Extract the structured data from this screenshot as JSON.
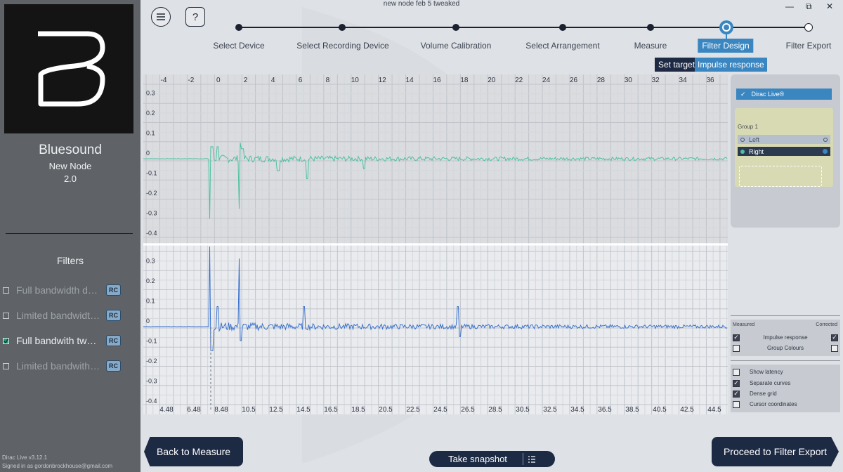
{
  "window": {
    "title": "new node feb 5 tweaked",
    "controls": [
      "—",
      "⧉",
      "✕"
    ]
  },
  "device": {
    "brand": "Bluesound",
    "name": "New Node",
    "version": "2.0"
  },
  "filters": {
    "heading": "Filters",
    "items": [
      {
        "label": "Full bandwidth default",
        "badge": "RC",
        "checked": false
      },
      {
        "label": "Limited bandwidth default",
        "badge": "RC",
        "checked": false
      },
      {
        "label": "Full bandwith tweaked",
        "badge": "RC",
        "checked": true
      },
      {
        "label": "Limited bandwith tweaked",
        "badge": "RC",
        "checked": false
      }
    ]
  },
  "footer": {
    "app_version": "Dirac Live v3.12.1",
    "signed_in": "Signed in as gordonbrockhouse@gmail.com"
  },
  "toolbar": {
    "menu_icon": "menu-icon",
    "help_label": "?"
  },
  "steps": {
    "items": [
      "Select Device",
      "Select Recording Device",
      "Volume Calibration",
      "Select Arrangement",
      "Measure",
      "Filter Design",
      "Filter Export"
    ],
    "active_index": 5
  },
  "view_tabs": {
    "set_target": "Set target",
    "impulse_response": "Impulse response",
    "active": "Impulse response"
  },
  "plot": {
    "top_axis_labels": [
      "-4",
      "-2",
      "0",
      "2",
      "4",
      "6",
      "8",
      "10",
      "12",
      "14",
      "16",
      "18",
      "20",
      "22",
      "24",
      "26",
      "28",
      "30",
      "32",
      "34",
      "36"
    ],
    "bottom_axis_labels": [
      "4.48",
      "6.48",
      "8.48",
      "10.5",
      "12.5",
      "14.5",
      "16.5",
      "18.5",
      "20.5",
      "22.5",
      "24.5",
      "26.5",
      "28.5",
      "30.5",
      "32.5",
      "34.5",
      "36.5",
      "38.5",
      "40.5",
      "42.5",
      "44.5"
    ],
    "upper_y_labels": [
      "0.3",
      "0.2",
      "0.1",
      "0",
      "-0.1",
      "-0.2",
      "-0.3",
      "-0.4"
    ],
    "lower_y_labels": [
      "0.3",
      "0.2",
      "0.1",
      "0",
      "-0.1",
      "-0.2",
      "-0.3",
      "-0.4"
    ],
    "measured_color": "#4ec1a2",
    "corrected_color": "#3a72cc"
  },
  "right_panel": {
    "dirac_label": "Dirac Live®",
    "group_label": "Group 1",
    "channels": [
      {
        "label": "Left",
        "selected": false
      },
      {
        "label": "Right",
        "selected": true
      }
    ]
  },
  "curve_options": {
    "measured_header": "Measured",
    "corrected_header": "Corrected",
    "rows": [
      {
        "label": "Impulse response",
        "measured": true,
        "corrected": true
      },
      {
        "label": "Group Colours",
        "measured": false,
        "corrected": false
      }
    ]
  },
  "display_options": [
    {
      "label": "Show latency",
      "checked": false
    },
    {
      "label": "Separate curves",
      "checked": true
    },
    {
      "label": "Dense grid",
      "checked": true
    },
    {
      "label": "Cursor coordinates",
      "checked": false
    }
  ],
  "buttons": {
    "back": "Back to Measure",
    "snapshot": "Take snapshot",
    "proceed": "Proceed to Filter Export"
  }
}
